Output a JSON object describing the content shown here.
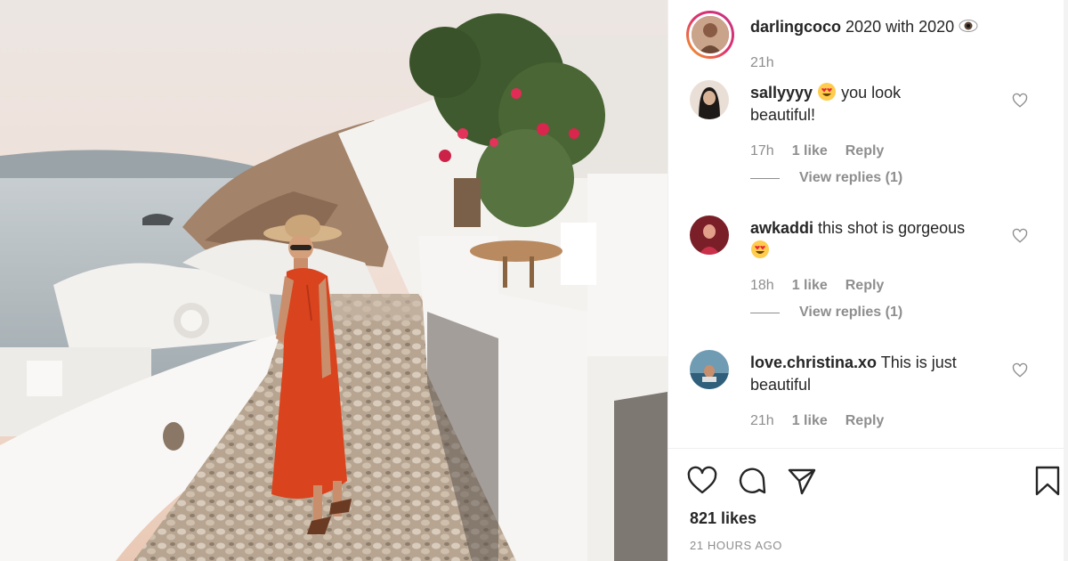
{
  "post": {
    "author": "darlingcoco",
    "caption": "2020 with 2020",
    "time": "21h",
    "caption_icon": "eye-emoji"
  },
  "comments": [
    {
      "user": "sallyyyy",
      "emoji": "heart-eyes-emoji",
      "text_line1": "you look",
      "text_line2": "beautiful!",
      "time": "17h",
      "likes": "1 like",
      "reply": "Reply",
      "view_replies": "View replies (1)"
    },
    {
      "user": "awkaddi",
      "text_line1": "this shot is gorgeous",
      "emoji": "heart-eyes-emoji",
      "time": "18h",
      "likes": "1 like",
      "reply": "Reply",
      "view_replies": "View replies (1)"
    },
    {
      "user": "love.christina.xo",
      "text_line1": "This is just",
      "text_line2": "beautiful",
      "time": "21h",
      "likes": "1 like",
      "reply": "Reply"
    }
  ],
  "actions": {
    "likes": "821 likes",
    "timestamp": "21 HOURS AGO",
    "icons": [
      "heart-icon",
      "comment-icon",
      "share-icon",
      "bookmark-icon"
    ]
  },
  "colors": {
    "dress": "#d9431e",
    "sky": "#efe3dc",
    "sea": "#b9c3c6",
    "muted_text": "#8e8e8e",
    "story_ring": "#e1306c"
  }
}
